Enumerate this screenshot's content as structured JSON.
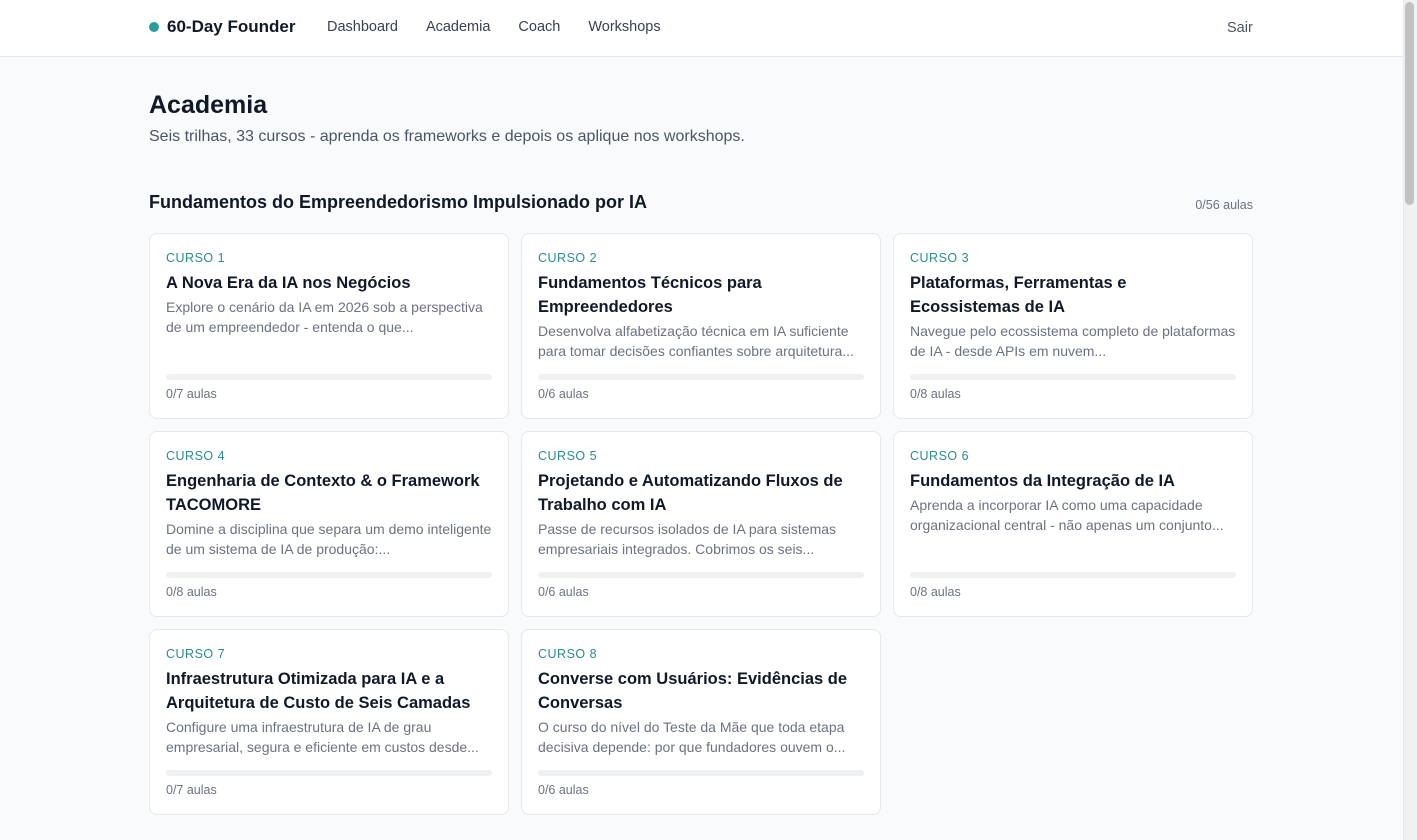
{
  "header": {
    "brand": "60-Day Founder",
    "nav": [
      "Dashboard",
      "Academia",
      "Coach",
      "Workshops"
    ],
    "logout": "Sair",
    "accent": "#2a9d9d"
  },
  "page": {
    "title": "Academia",
    "subtitle": "Seis trilhas, 33 cursos - aprenda os frameworks e depois os aplique nos workshops."
  },
  "track": {
    "title": "Fundamentos do Empreendedorismo Impulsionado por IA",
    "count": "0/56 aulas"
  },
  "courses": [
    {
      "kicker": "CURSO 1",
      "title": "A Nova Era da IA nos Negócios",
      "desc": "Explore o cenário da IA em 2026 sob a perspectiva de um empreendedor - entenda o que...",
      "count": "0/7 aulas",
      "progress": 0
    },
    {
      "kicker": "CURSO 2",
      "title": "Fundamentos Técnicos para Empreendedores",
      "desc": "Desenvolva alfabetização técnica em IA suficiente para tomar decisões confiantes sobre arquitetura...",
      "count": "0/6 aulas",
      "progress": 0
    },
    {
      "kicker": "CURSO 3",
      "title": "Plataformas, Ferramentas e Ecossistemas de IA",
      "desc": "Navegue pelo ecossistema completo de plataformas de IA - desde APIs em nuvem...",
      "count": "0/8 aulas",
      "progress": 0
    },
    {
      "kicker": "CURSO 4",
      "title": "Engenharia de Contexto & o Framework TACOMORE",
      "desc": "Domine a disciplina que separa um demo inteligente de um sistema de IA de produção:...",
      "count": "0/8 aulas",
      "progress": 0
    },
    {
      "kicker": "CURSO 5",
      "title": "Projetando e Automatizando Fluxos de Trabalho com IA",
      "desc": "Passe de recursos isolados de IA para sistemas empresariais integrados. Cobrimos os seis...",
      "count": "0/6 aulas",
      "progress": 0
    },
    {
      "kicker": "CURSO 6",
      "title": "Fundamentos da Integração de IA",
      "desc": "Aprenda a incorporar IA como uma capacidade organizacional central - não apenas um conjunto...",
      "count": "0/8 aulas",
      "progress": 0
    },
    {
      "kicker": "CURSO 7",
      "title": "Infraestrutura Otimizada para IA e a Arquitetura de Custo de Seis Camadas",
      "desc": "Configure uma infraestrutura de IA de grau empresarial, segura e eficiente em custos desde...",
      "count": "0/7 aulas",
      "progress": 0
    },
    {
      "kicker": "CURSO 8",
      "title": "Converse com Usuários: Evidências de Conversas",
      "desc": "O curso do nível do Teste da Mãe que toda etapa decisiva depende: por que fundadores ouvem o...",
      "count": "0/6 aulas",
      "progress": 0
    }
  ]
}
